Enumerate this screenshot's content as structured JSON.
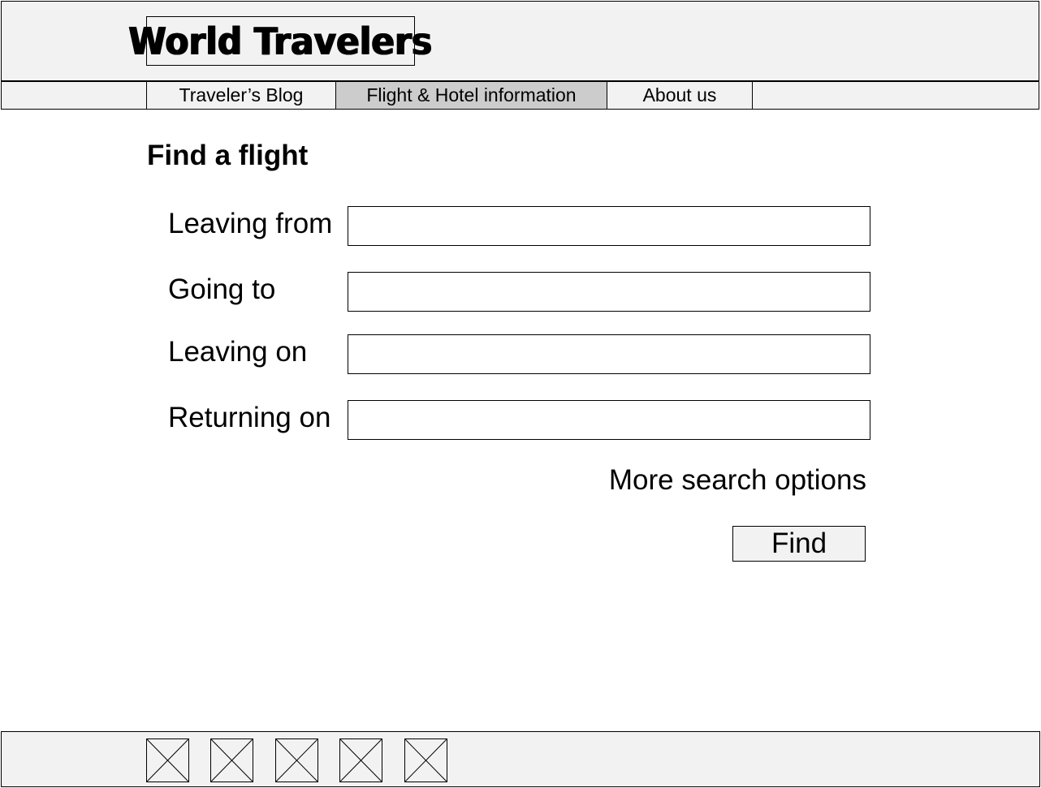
{
  "header": {
    "logo_text": "World Travelers"
  },
  "nav": {
    "tabs": [
      {
        "label": "Traveler’s Blog",
        "active": false
      },
      {
        "label": "Flight & Hotel information",
        "active": true
      },
      {
        "label": "About us",
        "active": false
      }
    ]
  },
  "main": {
    "title": "Find a flight",
    "fields": [
      {
        "label": "Leaving from",
        "value": "",
        "placeholder": ""
      },
      {
        "label": "Going to",
        "value": "",
        "placeholder": ""
      },
      {
        "label": "Leaving on",
        "value": "",
        "placeholder": ""
      },
      {
        "label": "Returning on",
        "value": "",
        "placeholder": ""
      }
    ],
    "more_options_label": "More search options",
    "find_label": "Find"
  },
  "footer": {
    "image_placeholders": [
      "image-placeholder-icon",
      "image-placeholder-icon",
      "image-placeholder-icon",
      "image-placeholder-icon",
      "image-placeholder-icon"
    ]
  },
  "colors": {
    "panel_bg": "#f2f2f2",
    "active_tab_bg": "#cccccc",
    "border": "#000000"
  }
}
